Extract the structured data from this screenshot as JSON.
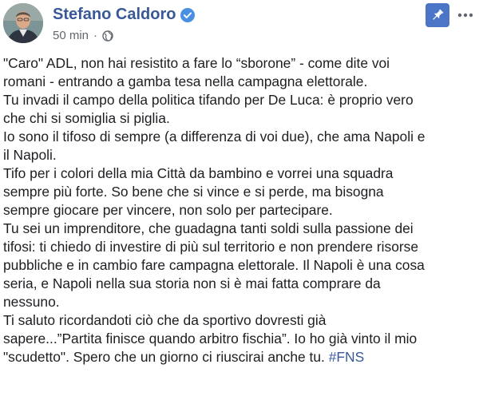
{
  "post": {
    "author": "Stefano Caldoro",
    "time": "50 min",
    "separator": "·",
    "audience_icon": "globe-icon",
    "verified_icon": "verified-badge-icon",
    "pin_icon": "pin-icon",
    "more_icon": "more-options-icon",
    "lines": [
      "\"Caro\" ADL, non hai resistito a fare lo “sborone” - come dite voi",
      "romani - entrando a gamba tesa nella campagna elettorale.",
      "Tu invadi il campo della politica tifando per De Luca: è proprio vero",
      "che chi si somiglia si piglia.",
      "Io sono il tifoso di sempre (a differenza di voi due), che ama Napoli e",
      "il Napoli.",
      "Tifo per i colori della mia Città da bambino e vorrei una squadra",
      "sempre più forte. So bene che si vince e si perde, ma bisogna",
      "sempre giocare per vincere, non solo per partecipare.",
      "Tu sei un imprenditore, che guadagna tanti soldi sulla passione dei",
      "tifosi: ti chiedo di investire di più sul territorio e non prendere risorse",
      "pubbliche e in cambio fare campagna elettorale. Il Napoli è una cosa",
      "seria, e Napoli nella sua storia non si è mai fatta comprare da",
      "nessuno.",
      "Ti saluto ricordandoti ciò che da sportivo dovresti già",
      "sapere...”Partita finisce quando arbitro fischia”. Io ho già vinto il mio"
    ],
    "last_line_text": "\"scudetto\". Spero che un giorno ci riuscirai anche tu. ",
    "hashtag": "#FNS"
  },
  "colors": {
    "author": "#385898",
    "meta": "#616770",
    "text": "#1c1e21",
    "pin_bg": "#4b76c8",
    "verified": "#4a90e2"
  }
}
